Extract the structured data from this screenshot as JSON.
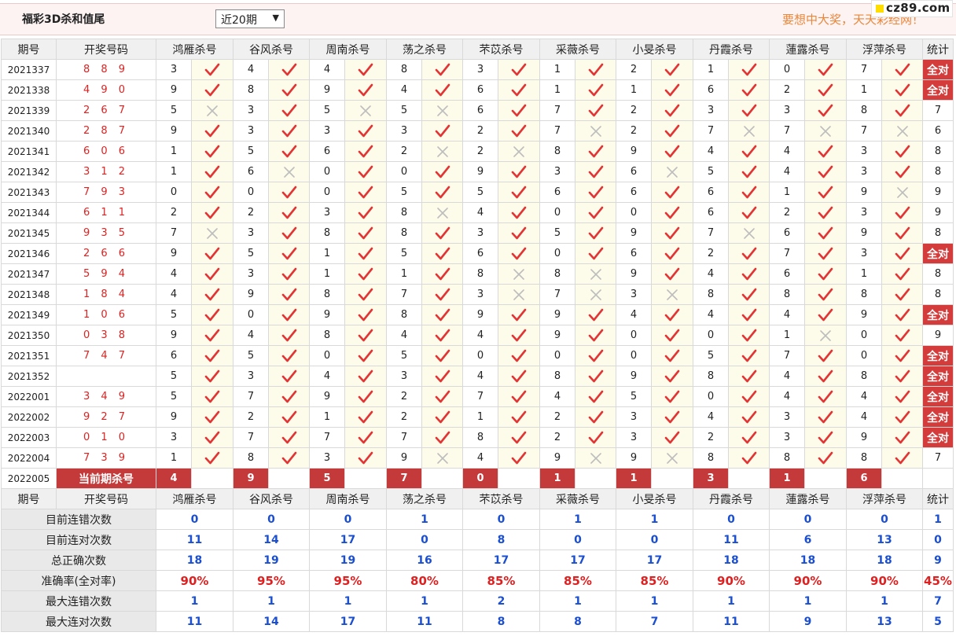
{
  "title": "福彩3D杀和值尾",
  "range_select": "近20期",
  "slogan": "要想中大奖，天天彩经网！",
  "logo_text": "cz89.com",
  "headers": {
    "issue": "期号",
    "drawn": "开奖号码",
    "experts": [
      "鸿雁杀号",
      "谷风杀号",
      "周南杀号",
      "荡之杀号",
      "芣苡杀号",
      "采薇杀号",
      "小旻杀号",
      "丹霞杀号",
      "蓮露杀号",
      "浮萍杀号"
    ],
    "stat": "统计"
  },
  "all_correct_label": "全对",
  "rows": [
    {
      "issue": "2021337",
      "drawn": "8 8 9",
      "picks": [
        "3",
        "4",
        "4",
        "8",
        "3",
        "1",
        "2",
        "1",
        "0",
        "7"
      ],
      "ok": [
        1,
        1,
        1,
        1,
        1,
        1,
        1,
        1,
        1,
        1
      ],
      "stat": "全对"
    },
    {
      "issue": "2021338",
      "drawn": "4 9 0",
      "picks": [
        "9",
        "8",
        "9",
        "4",
        "6",
        "1",
        "1",
        "6",
        "2",
        "1"
      ],
      "ok": [
        1,
        1,
        1,
        1,
        1,
        1,
        1,
        1,
        1,
        1
      ],
      "stat": "全对"
    },
    {
      "issue": "2021339",
      "drawn": "2 6 7",
      "picks": [
        "5",
        "3",
        "5",
        "5",
        "6",
        "7",
        "2",
        "3",
        "3",
        "8"
      ],
      "ok": [
        0,
        1,
        0,
        0,
        1,
        1,
        1,
        1,
        1,
        1
      ],
      "stat": "7"
    },
    {
      "issue": "2021340",
      "drawn": "2 8 7",
      "picks": [
        "9",
        "3",
        "3",
        "3",
        "2",
        "7",
        "2",
        "7",
        "7",
        "7"
      ],
      "ok": [
        1,
        1,
        1,
        1,
        1,
        0,
        1,
        0,
        0,
        0
      ],
      "stat": "6"
    },
    {
      "issue": "2021341",
      "drawn": "6 0 6",
      "picks": [
        "1",
        "5",
        "6",
        "2",
        "2",
        "8",
        "9",
        "4",
        "4",
        "3"
      ],
      "ok": [
        1,
        1,
        1,
        0,
        0,
        1,
        1,
        1,
        1,
        1
      ],
      "stat": "8"
    },
    {
      "issue": "2021342",
      "drawn": "3 1 2",
      "picks": [
        "1",
        "6",
        "0",
        "0",
        "9",
        "3",
        "6",
        "5",
        "4",
        "3"
      ],
      "ok": [
        1,
        0,
        1,
        1,
        1,
        1,
        0,
        1,
        1,
        1
      ],
      "stat": "8"
    },
    {
      "issue": "2021343",
      "drawn": "7 9 3",
      "picks": [
        "0",
        "0",
        "0",
        "5",
        "5",
        "6",
        "6",
        "6",
        "1",
        "9"
      ],
      "ok": [
        1,
        1,
        1,
        1,
        1,
        1,
        1,
        1,
        1,
        0
      ],
      "stat": "9"
    },
    {
      "issue": "2021344",
      "drawn": "6 1 1",
      "picks": [
        "2",
        "2",
        "3",
        "8",
        "4",
        "0",
        "0",
        "6",
        "2",
        "3"
      ],
      "ok": [
        1,
        1,
        1,
        0,
        1,
        1,
        1,
        1,
        1,
        1
      ],
      "stat": "9"
    },
    {
      "issue": "2021345",
      "drawn": "9 3 5",
      "picks": [
        "7",
        "3",
        "8",
        "8",
        "3",
        "5",
        "9",
        "7",
        "6",
        "9"
      ],
      "ok": [
        0,
        1,
        1,
        1,
        1,
        1,
        1,
        0,
        1,
        1
      ],
      "stat": "8"
    },
    {
      "issue": "2021346",
      "drawn": "2 6 6",
      "picks": [
        "9",
        "5",
        "1",
        "5",
        "6",
        "0",
        "6",
        "2",
        "7",
        "3"
      ],
      "ok": [
        1,
        1,
        1,
        1,
        1,
        1,
        1,
        1,
        1,
        1
      ],
      "stat": "全对"
    },
    {
      "issue": "2021347",
      "drawn": "5 9 4",
      "picks": [
        "4",
        "3",
        "1",
        "1",
        "8",
        "8",
        "9",
        "4",
        "6",
        "1"
      ],
      "ok": [
        1,
        1,
        1,
        1,
        0,
        0,
        1,
        1,
        1,
        1
      ],
      "stat": "8"
    },
    {
      "issue": "2021348",
      "drawn": "1 8 4",
      "picks": [
        "4",
        "9",
        "8",
        "7",
        "3",
        "7",
        "3",
        "8",
        "8",
        "8"
      ],
      "ok": [
        1,
        1,
        1,
        1,
        0,
        0,
        0,
        1,
        1,
        1
      ],
      "stat": "8"
    },
    {
      "issue": "2021349",
      "drawn": "1 0 6",
      "picks": [
        "5",
        "0",
        "9",
        "8",
        "9",
        "9",
        "4",
        "4",
        "4",
        "9"
      ],
      "ok": [
        1,
        1,
        1,
        1,
        1,
        1,
        1,
        1,
        1,
        1
      ],
      "stat": "全对"
    },
    {
      "issue": "2021350",
      "drawn": "0 3 8",
      "picks": [
        "9",
        "4",
        "8",
        "4",
        "4",
        "9",
        "0",
        "0",
        "1",
        "0"
      ],
      "ok": [
        1,
        1,
        1,
        1,
        1,
        1,
        1,
        1,
        0,
        1
      ],
      "stat": "9"
    },
    {
      "issue": "2021351",
      "drawn": "7 4 7",
      "picks": [
        "6",
        "5",
        "0",
        "5",
        "0",
        "0",
        "0",
        "5",
        "7",
        "0"
      ],
      "ok": [
        1,
        1,
        1,
        1,
        1,
        1,
        1,
        1,
        1,
        1
      ],
      "stat": "全对"
    },
    {
      "issue": "2021352",
      "drawn": "",
      "picks": [
        "5",
        "3",
        "4",
        "3",
        "4",
        "8",
        "9",
        "8",
        "4",
        "8"
      ],
      "ok": [
        1,
        1,
        1,
        1,
        1,
        1,
        1,
        1,
        1,
        1
      ],
      "stat": "全对"
    },
    {
      "issue": "2022001",
      "drawn": "3 4 9",
      "picks": [
        "5",
        "7",
        "9",
        "2",
        "7",
        "4",
        "5",
        "0",
        "4",
        "4"
      ],
      "ok": [
        1,
        1,
        1,
        1,
        1,
        1,
        1,
        1,
        1,
        1
      ],
      "stat": "全对"
    },
    {
      "issue": "2022002",
      "drawn": "9 2 7",
      "picks": [
        "9",
        "2",
        "1",
        "2",
        "1",
        "2",
        "3",
        "4",
        "3",
        "4"
      ],
      "ok": [
        1,
        1,
        1,
        1,
        1,
        1,
        1,
        1,
        1,
        1
      ],
      "stat": "全对"
    },
    {
      "issue": "2022003",
      "drawn": "0 1 0",
      "picks": [
        "3",
        "7",
        "7",
        "7",
        "8",
        "2",
        "3",
        "2",
        "3",
        "9"
      ],
      "ok": [
        1,
        1,
        1,
        1,
        1,
        1,
        1,
        1,
        1,
        1
      ],
      "stat": "全对"
    },
    {
      "issue": "2022004",
      "drawn": "7 3 9",
      "picks": [
        "1",
        "8",
        "3",
        "9",
        "4",
        "9",
        "9",
        "8",
        "8",
        "8"
      ],
      "ok": [
        1,
        1,
        1,
        0,
        1,
        0,
        0,
        1,
        1,
        1
      ],
      "stat": "7"
    }
  ],
  "current": {
    "issue": "2022005",
    "label": "当前期杀号",
    "picks": [
      "4",
      "9",
      "5",
      "7",
      "0",
      "1",
      "1",
      "3",
      "1",
      "6"
    ]
  },
  "summary": [
    {
      "label": "目前连错次数",
      "values": [
        "0",
        "0",
        "0",
        "1",
        "0",
        "1",
        "1",
        "0",
        "0",
        "0"
      ],
      "stat": "1",
      "red": false
    },
    {
      "label": "目前连对次数",
      "values": [
        "11",
        "14",
        "17",
        "0",
        "8",
        "0",
        "0",
        "11",
        "6",
        "13"
      ],
      "stat": "0",
      "red": false
    },
    {
      "label": "总正确次数",
      "values": [
        "18",
        "19",
        "19",
        "16",
        "17",
        "17",
        "17",
        "18",
        "18",
        "18"
      ],
      "stat": "9",
      "red": false
    },
    {
      "label": "准确率(全对率)",
      "values": [
        "90%",
        "95%",
        "95%",
        "80%",
        "85%",
        "85%",
        "85%",
        "90%",
        "90%",
        "90%"
      ],
      "stat": "45%",
      "red": true
    },
    {
      "label": "最大连错次数",
      "values": [
        "1",
        "1",
        "1",
        "1",
        "2",
        "1",
        "1",
        "1",
        "1",
        "1"
      ],
      "stat": "7",
      "red": false
    },
    {
      "label": "最大连对次数",
      "values": [
        "11",
        "14",
        "17",
        "11",
        "8",
        "8",
        "7",
        "11",
        "9",
        "13"
      ],
      "stat": "5",
      "red": false
    }
  ]
}
